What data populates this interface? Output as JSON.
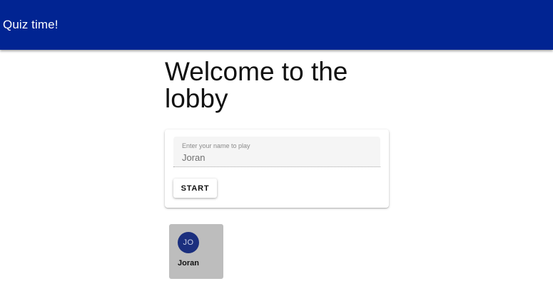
{
  "app_bar": {
    "title": "Quiz time!",
    "background_color": "#012492"
  },
  "main": {
    "heading": "Welcome to the lobby"
  },
  "name_form": {
    "field_label": "Enter your name to play",
    "field_value": "Joran",
    "start_label": "START"
  },
  "players": [
    {
      "initials": "JO",
      "name": "Joran",
      "avatar_color": "#1b2f7e"
    }
  ]
}
